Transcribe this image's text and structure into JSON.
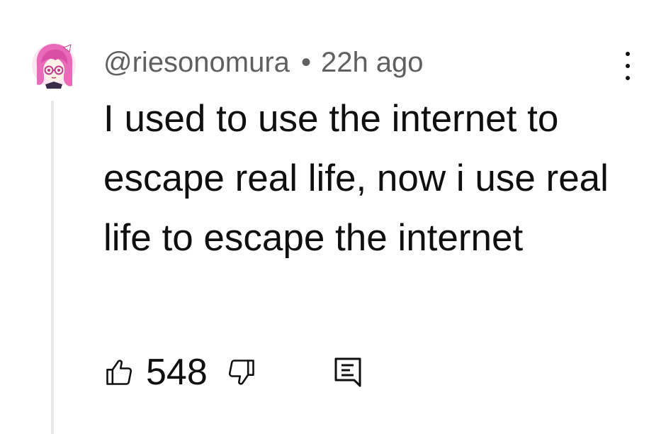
{
  "comment": {
    "author": "@riesonomura",
    "separator": "•",
    "timestamp": "22h ago",
    "text": "I used to use the internet to escape real life, now i use real life to escape the internet",
    "like_count": "548"
  },
  "icons": {
    "avatar": "anime-avatar-pink-hair",
    "menu": "more-vert-icon",
    "like": "thumbs-up-icon",
    "dislike": "thumbs-down-icon",
    "reply": "comment-reply-icon"
  },
  "colors": {
    "text_primary": "#0f0f0f",
    "text_secondary": "#606060",
    "thread_line": "#e8e8e8",
    "avatar_hair": "#e86ab8"
  }
}
